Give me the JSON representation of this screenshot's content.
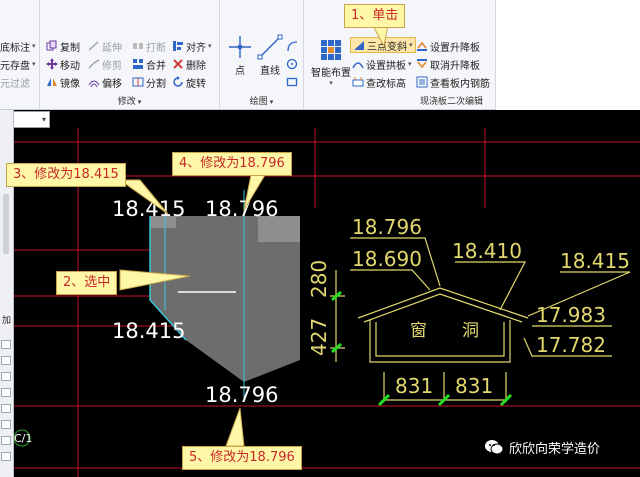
{
  "ribbon": {
    "modify": {
      "label": "修改",
      "items": {
        "copy": "复制",
        "extend": "延伸",
        "break": "打断",
        "align": "对齐",
        "move": "移动",
        "trim": "修剪",
        "merge": "合并",
        "delete": "删除",
        "mirror": "镜像",
        "offset": "偏移",
        "split": "分割",
        "rotate": "旋转"
      }
    },
    "left_partial": {
      "row1": "底标注",
      "row2": "元存盘",
      "row3": "元过滤"
    },
    "draw": {
      "label": "绘图",
      "point": "点",
      "line": "直线"
    },
    "slab": {
      "label": "现浇板二次编辑",
      "smart_layout": "智能布置",
      "three_point_slope": "三点变斜",
      "set_arch": "设置拱板",
      "view_elevation": "查改标高",
      "set_lift": "设置升降板",
      "cancel_lift": "取消升降板",
      "view_rebar": "查看板内钢筋"
    }
  },
  "left_panel": {
    "label_add": "加",
    "label_c1": "C/1"
  },
  "drawing": {
    "plan_labels": {
      "top_left": "18.415",
      "top_right": "18.796",
      "mid_left": "18.415",
      "bottom": "18.796"
    },
    "section_labels": {
      "e1": "18.796",
      "e2": "18.690",
      "e3": "18.410",
      "e4": "18.415",
      "e5": "17.983",
      "e6": "17.782",
      "dim_left_top": "280",
      "dim_left_bottom": "427",
      "dim_bottom_left": "831",
      "dim_bottom_right": "831",
      "window_a": "窗",
      "window_b": "洞"
    }
  },
  "callouts": {
    "c1": "1、单击",
    "c2": "2、选中",
    "c3": "3、修改为18.415",
    "c4": "4、修改为18.796",
    "c5": "5、修改为18.796"
  },
  "watermark": {
    "text": "欣欣向荣学造价",
    "icon": "wechat-icon"
  },
  "colors": {
    "canvas_bg": "#000000",
    "grid_red": "#c4122a",
    "slab_fill": "#6d6d6d",
    "slab_edge": "#39c6d8",
    "section_line": "#e2d86e",
    "tick_green": "#22dd22",
    "callout_bg": "#fff7a8",
    "callout_text": "#c62828"
  }
}
